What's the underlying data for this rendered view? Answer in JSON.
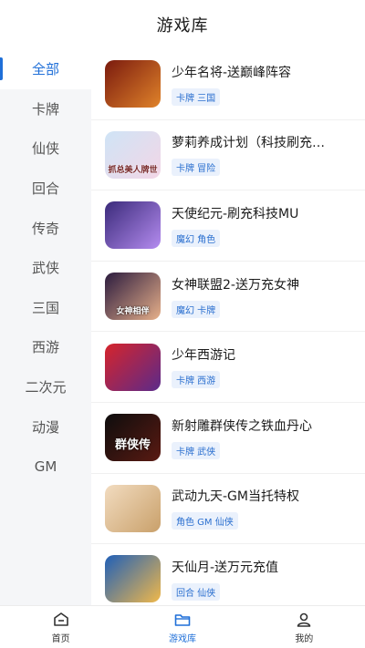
{
  "header": {
    "title": "游戏库"
  },
  "sidebar": {
    "items": [
      {
        "label": "全部",
        "active": true
      },
      {
        "label": "卡牌"
      },
      {
        "label": "仙侠"
      },
      {
        "label": "回合"
      },
      {
        "label": "传奇"
      },
      {
        "label": "武侠"
      },
      {
        "label": "三国"
      },
      {
        "label": "西游"
      },
      {
        "label": "二次元"
      },
      {
        "label": "动漫"
      },
      {
        "label": "GM"
      }
    ]
  },
  "games": [
    {
      "name": "少年名将-送巅峰阵容",
      "tags": "卡牌 三国",
      "thumb_colors": [
        "#7a1a0e",
        "#e0832a"
      ],
      "thumb_text": ""
    },
    {
      "name": "萝莉养成计划（科技刷充…",
      "tags": "卡牌 冒险",
      "thumb_colors": [
        "#cfe4f6",
        "#f3d6e6"
      ],
      "thumb_text": "抓总美人牌世"
    },
    {
      "name": "天使纪元-刷充科技MU",
      "tags": "魔幻 角色",
      "thumb_colors": [
        "#3a2a7a",
        "#b58cf0"
      ],
      "thumb_text": ""
    },
    {
      "name": "女神联盟2-送万充女神",
      "tags": "魔幻 卡牌",
      "thumb_colors": [
        "#2b1b3e",
        "#e7b08a"
      ],
      "thumb_text": "女神相伴"
    },
    {
      "name": "少年西游记",
      "tags": "卡牌 西游",
      "thumb_colors": [
        "#d6242b",
        "#5b2a8a"
      ],
      "thumb_text": ""
    },
    {
      "name": "新射雕群侠传之铁血丹心",
      "tags": "卡牌 武侠",
      "thumb_colors": [
        "#0d0d0d",
        "#5a1a12"
      ],
      "thumb_text": "群侠传"
    },
    {
      "name": "武动九天-GM当托特权",
      "tags": "角色 GM 仙侠",
      "thumb_colors": [
        "#f2dcc0",
        "#c9a06a"
      ],
      "thumb_text": ""
    },
    {
      "name": "天仙月-送万元充值",
      "tags": "回合 仙侠",
      "thumb_colors": [
        "#1f5fb8",
        "#f0b84a"
      ],
      "thumb_text": ""
    }
  ],
  "tabbar": {
    "items": [
      {
        "label": "首页"
      },
      {
        "label": "游戏库",
        "active": true
      },
      {
        "label": "我的"
      }
    ]
  },
  "colors": {
    "accent": "#1f6fd8",
    "sidebar_bg": "#f5f6f8",
    "tag_bg": "#eaf1fc"
  }
}
